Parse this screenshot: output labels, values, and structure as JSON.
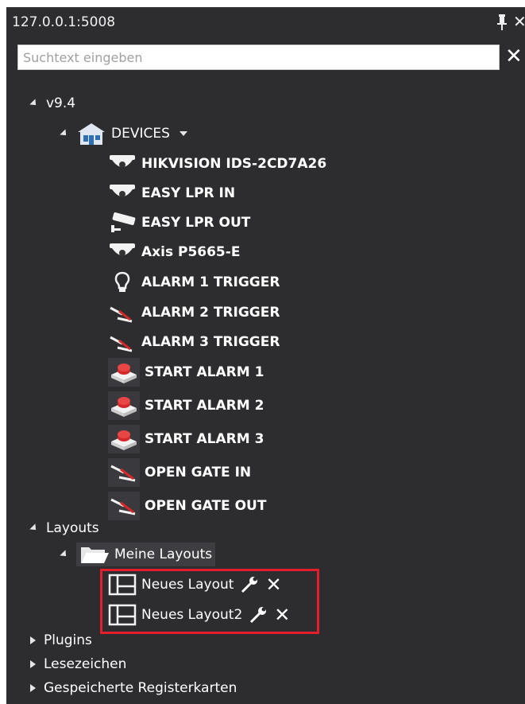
{
  "panel": {
    "title": "127.0.0.1:5008",
    "pin_icon": "pin-icon",
    "close_icon": "close-icon",
    "close_glyph": "✕"
  },
  "search": {
    "placeholder": "Suchtext eingeben",
    "value": "",
    "clear_glyph": "✕"
  },
  "tree": {
    "root": {
      "label": "v9.4"
    },
    "devices": {
      "label": "DEVICES",
      "items": [
        {
          "label": "HIKVISION IDS-2CD7A26",
          "icon": "dome-camera-icon"
        },
        {
          "label": "EASY LPR IN",
          "icon": "dome-camera-icon"
        },
        {
          "label": "EASY LPR OUT",
          "icon": "bullet-camera-icon"
        },
        {
          "label": "Axis P5665-E",
          "icon": "dome-camera-icon"
        },
        {
          "label": "ALARM 1 TRIGGER",
          "icon": "lightbulb-icon"
        },
        {
          "label": "ALARM 2 TRIGGER",
          "icon": "relay-icon"
        },
        {
          "label": "ALARM 3 TRIGGER",
          "icon": "relay-icon"
        },
        {
          "label": "START ALARM 1",
          "icon": "alarm-button-icon"
        },
        {
          "label": "START ALARM 2",
          "icon": "alarm-button-icon"
        },
        {
          "label": "START ALARM 3",
          "icon": "alarm-button-icon"
        },
        {
          "label": "OPEN GATE IN",
          "icon": "relay-icon"
        },
        {
          "label": "OPEN GATE OUT",
          "icon": "relay-icon"
        }
      ]
    },
    "layouts": {
      "label": "Layouts",
      "folder": {
        "label": "Meine Layouts"
      },
      "items": [
        {
          "label": "Neues Layout"
        },
        {
          "label": "Neues Layout2"
        }
      ]
    },
    "bottom": [
      {
        "label": "Plugins"
      },
      {
        "label": "Lesezeichen"
      },
      {
        "label": "Gespeicherte Registerkarten"
      }
    ]
  },
  "colors": {
    "panel_bg": "#2d2d30",
    "highlight": "#e41e2a"
  }
}
